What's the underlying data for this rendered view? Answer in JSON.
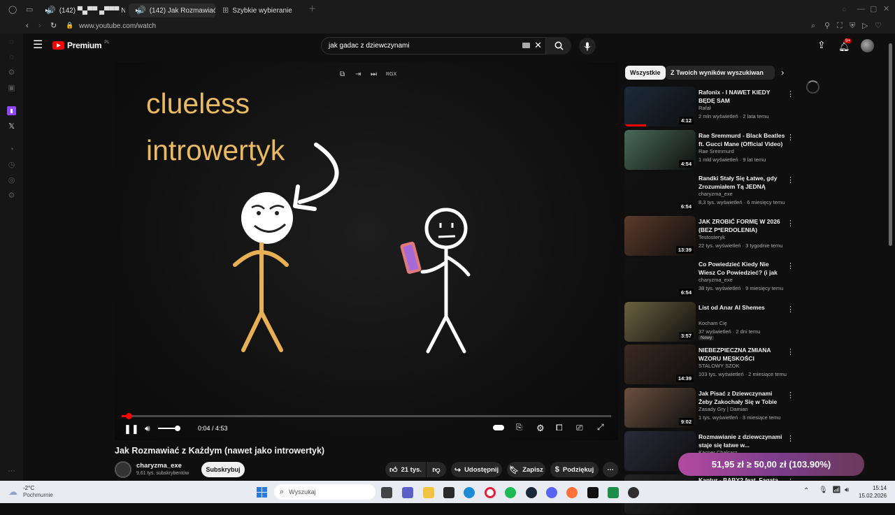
{
  "browser": {
    "tabs": [
      {
        "label": "(142) ▀▄▀▀ ▄▀▀▀ N"
      },
      {
        "label": "(142) Jak Rozmawiać z"
      },
      {
        "label": "Szybkie wybieranie"
      }
    ],
    "url": "www.youtube.com/watch"
  },
  "youtube": {
    "logo_text": "Premium",
    "logo_badge": "PL",
    "search_value": "jak gadac z dziewczynami",
    "notifications_badge": "9+"
  },
  "video": {
    "overlay_line1": "clueless",
    "overlay_line2": "introwertyk",
    "time": "0:04 / 4:53",
    "progress_fraction": 0.014,
    "top_label": "RGX",
    "title": "Jak Rozmawiać z Każdym (nawet jako introwertyk)",
    "channel": "charyzma_exe",
    "subscribers": "9,61 tys. subskrybentów",
    "subscribe_label": "Subskrybuj",
    "likes": "21 tys.",
    "share_label": "Udostępnij",
    "save_label": "Zapisz",
    "thanks_label": "Podziękuj"
  },
  "filters": [
    "Wszystkie",
    "Z Twoich wyników wyszukiwania"
  ],
  "recommendations": [
    {
      "title": "Rafonix - I NAWET KIEDY BĘDĘ SAM",
      "channel": "Rafał",
      "meta": "2 mln wyświetleń · 2 lata temu",
      "duration": "4:12",
      "thumb_color": "#1d2a3a"
    },
    {
      "title": "Rae Sremmurd - Black Beatles ft. Gucci Mane (Official Video)",
      "channel": "Rae Sremmurd",
      "meta": "1 mld wyświetleń · 9 lat temu",
      "duration": "4:54",
      "thumb_color": "#4a6a5a"
    },
    {
      "title": "Randki Stały Się Łatwe, gdy Zrozumiałem Tą JEDNĄ Rzecz.",
      "channel": "charyzma_exe",
      "meta": "8,3 tys. wyświetleń · 6 miesięcy temu",
      "duration": "6:54",
      "thumb_color": "#111111"
    },
    {
      "title": "JAK ZROBIĆ FORMĘ W 2026 (BEZ P*ERDOLENIA)",
      "channel": "Testosteryk",
      "meta": "22 tys. wyświetleń · 3 tygodnie temu",
      "duration": "13:39",
      "thumb_color": "#5a3a2a"
    },
    {
      "title": "Co Powiedzieć Kiedy Nie Wiesz Co Powiedzieć? (i jak uniknąć ...",
      "channel": "charyzma_exe",
      "meta": "38 tys. wyświetleń · 9 miesięcy temu",
      "duration": "6:54",
      "thumb_color": "#111111"
    },
    {
      "title": "List od Anar Al Shemes",
      "channel": "Kocham Cię",
      "meta": "37 wyświetleń · 2 dni temu",
      "badge": "Nowy",
      "duration": "3:57",
      "thumb_color": "#6a6040"
    },
    {
      "title": "NIEBEZPIECZNA ZMIANA WZORU MĘSKOŚCI",
      "channel": "STALOWY SZOK",
      "meta": "103 tys. wyświetleń · 2 miesiące temu",
      "duration": "14:39",
      "thumb_color": "#3a2a22"
    },
    {
      "title": "Jak Pisać z Dziewczynami Żeby Zakochały Się w Tobie",
      "channel": "Zasady Gry | Damian",
      "meta": "1 tys. wyświetleń · 3 miesiące temu",
      "duration": "9:02",
      "thumb_color": "#6a5040"
    },
    {
      "title": "Rozmawianie z dziewczynami staje się łatwe w...",
      "channel": "Kacper Chalcarz",
      "meta": "",
      "duration": "",
      "thumb_color": "#2a2a3a"
    },
    {
      "title": "Kantur - BABY? feat. Fagata",
      "channel": "",
      "meta": "",
      "duration": "",
      "thumb_color": "#222"
    }
  ],
  "overlay_ticker": "51,95 zł ≥ 50,00 zł (103.90%)",
  "taskbar": {
    "weather_temp": "-2°C",
    "weather_text": "Pochmurnie",
    "search_placeholder": "Wyszukaj",
    "time": "15:14",
    "date": "15.02.2026"
  },
  "colors": {
    "accent_red": "#ff0000",
    "chip_active_bg": "#f1f1f1"
  }
}
